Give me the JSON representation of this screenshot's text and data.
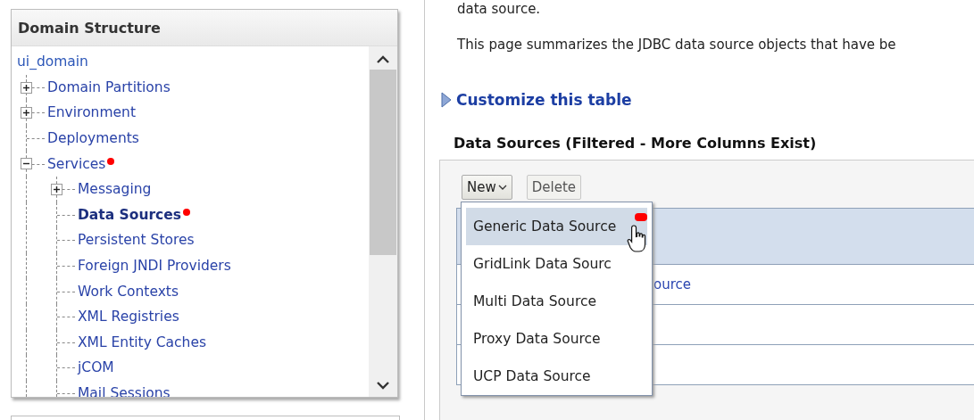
{
  "domain_structure": {
    "title": "Domain Structure",
    "tree": [
      {
        "label": "ui_domain",
        "selected": false,
        "children": [
          {
            "label": "Domain Partitions",
            "selected": false,
            "expanded": false
          },
          {
            "label": "Environment",
            "selected": false,
            "expanded": false
          },
          {
            "label": "Deployments",
            "selected": false
          },
          {
            "label": "Services",
            "selected": false,
            "expanded": true,
            "annotated": true,
            "children": [
              {
                "label": "Messaging",
                "selected": false,
                "expanded": false
              },
              {
                "label": "Data Sources",
                "selected": true,
                "annotated": true
              },
              {
                "label": "Persistent Stores",
                "selected": false
              },
              {
                "label": "Foreign JNDI Providers",
                "selected": false
              },
              {
                "label": "Work Contexts",
                "selected": false
              },
              {
                "label": "XML Registries",
                "selected": false
              },
              {
                "label": "XML Entity Caches",
                "selected": false
              },
              {
                "label": "jCOM",
                "selected": false
              },
              {
                "label": "Mail Sessions",
                "selected": false
              }
            ]
          }
        ]
      }
    ]
  },
  "intro": [
    "data source.",
    "This page summarizes the JDBC data source objects that have be"
  ],
  "customize_link": "Customize this table",
  "table": {
    "title": "Data Sources (Filtered - More Columns Exist)",
    "buttons": [
      {
        "label": "New",
        "kind": "dropdown",
        "disabled": false
      },
      {
        "label": "Delete",
        "kind": "plain",
        "disabled": true
      }
    ],
    "rows": [
      {
        "selected": true
      },
      {
        "selected": false,
        "text": "ource"
      },
      {
        "selected": false
      },
      {
        "selected": false
      }
    ]
  },
  "new_menu": [
    {
      "label": "Generic Data Source",
      "selected": true,
      "annotated": true
    },
    {
      "label": "GridLink Data Sourc",
      "selected": false,
      "annotated": false
    },
    {
      "label": "Multi Data Source",
      "selected": false,
      "annotated": false
    },
    {
      "label": "Proxy Data Source",
      "selected": false,
      "annotated": false
    },
    {
      "label": "UCP Data Source",
      "selected": false,
      "annotated": false
    }
  ]
}
